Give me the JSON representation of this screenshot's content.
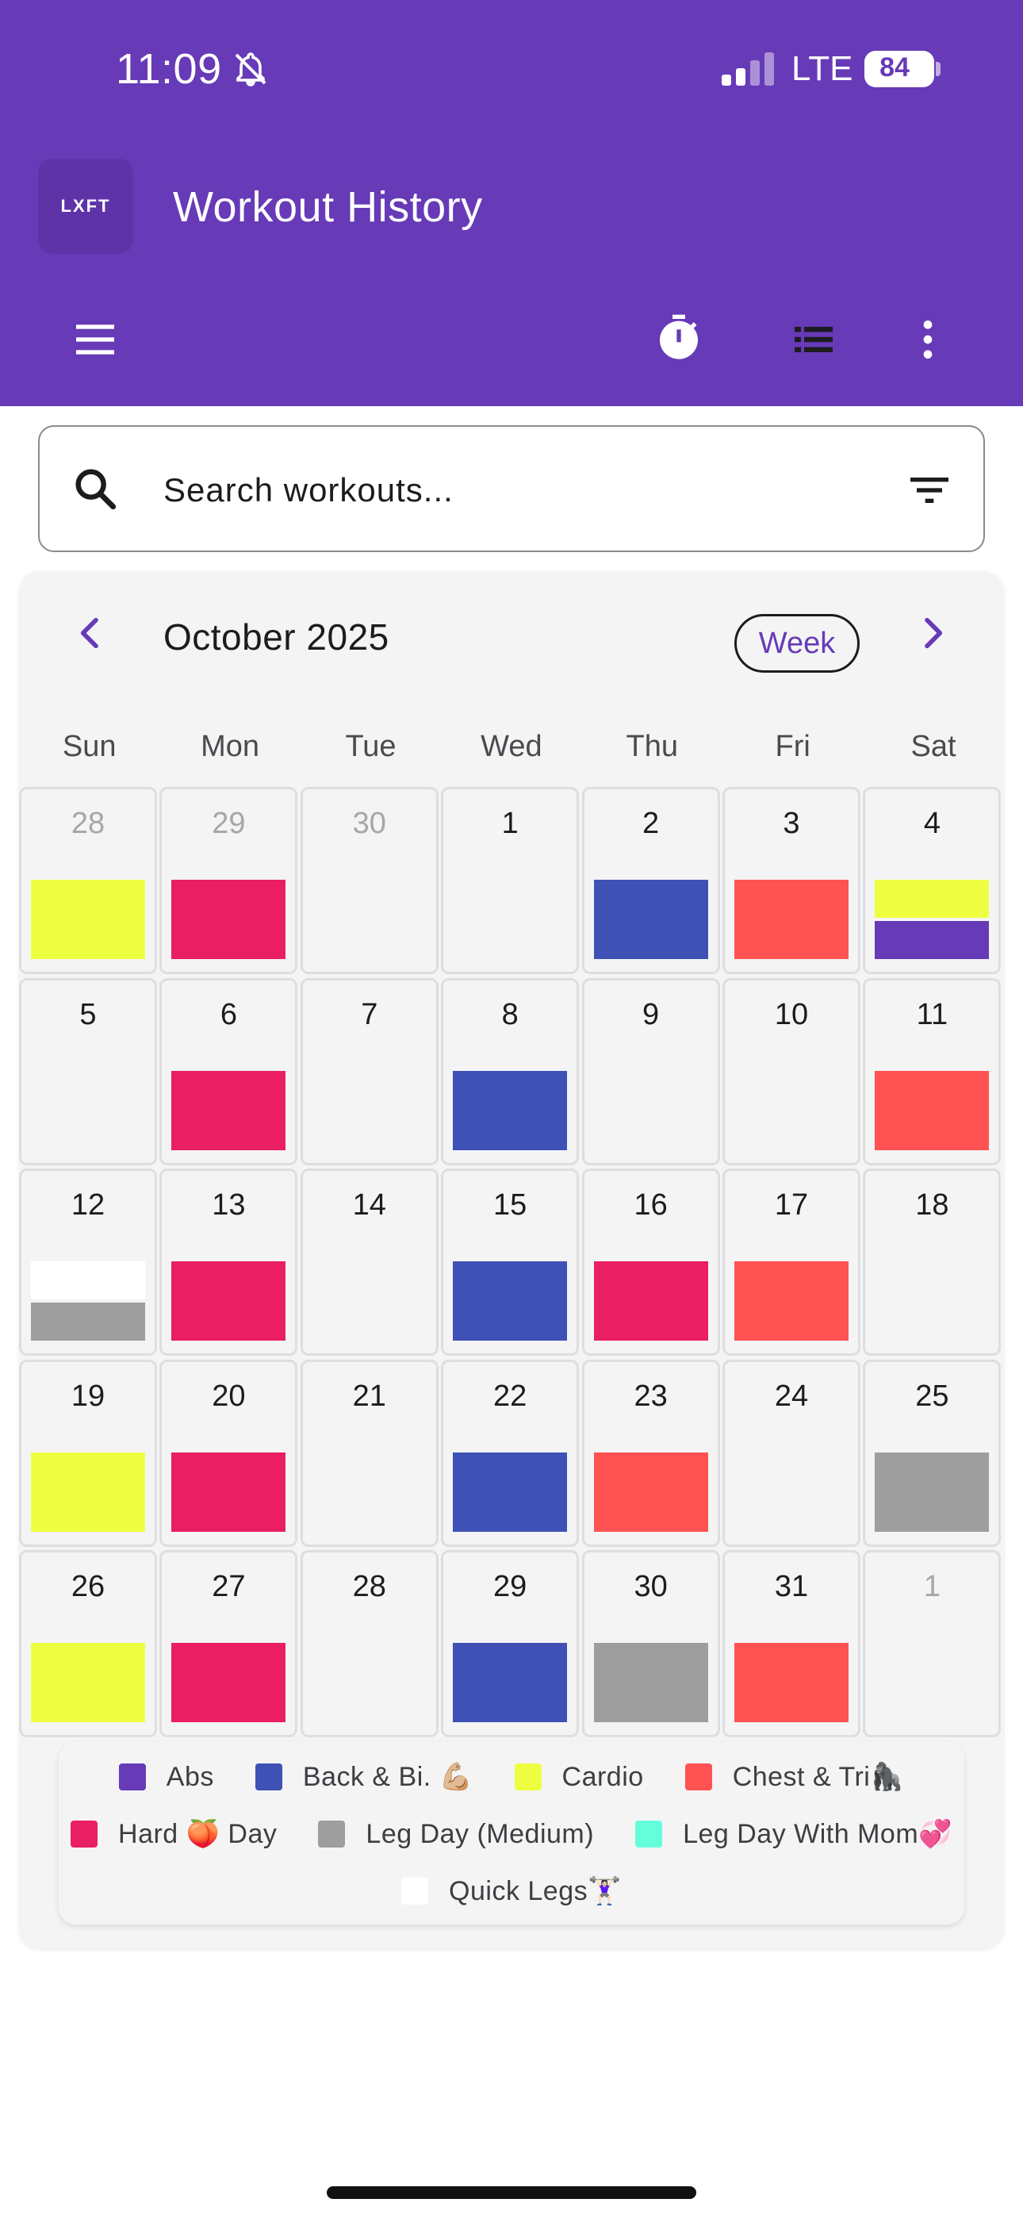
{
  "status_bar": {
    "time": "11:09",
    "network": "LTE",
    "battery": "84",
    "battery_level": 0.84
  },
  "header": {
    "logo_text": "LXFT",
    "title": "Workout History"
  },
  "toolbar": {
    "icons": [
      "menu-icon",
      "timer-icon",
      "list-icon",
      "more-vertical-icon"
    ]
  },
  "search": {
    "placeholder": "Search workouts..."
  },
  "calendar": {
    "month_label": "October 2025",
    "view_button": "Week",
    "weekdays": [
      "Sun",
      "Mon",
      "Tue",
      "Wed",
      "Thu",
      "Fri",
      "Sat"
    ],
    "weeks": [
      [
        {
          "day": "28",
          "outside": true,
          "workouts": [
            "Cardio"
          ]
        },
        {
          "day": "29",
          "outside": true,
          "workouts": [
            "Hard 🍑 Day"
          ]
        },
        {
          "day": "30",
          "outside": true,
          "workouts": []
        },
        {
          "day": "1",
          "workouts": []
        },
        {
          "day": "2",
          "workouts": [
            "Back & Bi. 💪🏼"
          ]
        },
        {
          "day": "3",
          "workouts": [
            "Chest & Tri🦍"
          ]
        },
        {
          "day": "4",
          "workouts": [
            "Cardio",
            "Abs"
          ]
        }
      ],
      [
        {
          "day": "5",
          "workouts": []
        },
        {
          "day": "6",
          "workouts": [
            "Hard 🍑 Day"
          ]
        },
        {
          "day": "7",
          "workouts": []
        },
        {
          "day": "8",
          "workouts": [
            "Back & Bi. 💪🏼"
          ]
        },
        {
          "day": "9",
          "workouts": []
        },
        {
          "day": "10",
          "workouts": []
        },
        {
          "day": "11",
          "workouts": [
            "Chest & Tri🦍"
          ]
        }
      ],
      [
        {
          "day": "12",
          "workouts": [
            "Quick Legs🏋🏻‍♀️",
            "Leg Day (Medium)"
          ]
        },
        {
          "day": "13",
          "workouts": [
            "Hard 🍑 Day"
          ]
        },
        {
          "day": "14",
          "workouts": []
        },
        {
          "day": "15",
          "workouts": [
            "Back & Bi. 💪🏼"
          ]
        },
        {
          "day": "16",
          "workouts": [
            "Hard 🍑 Day"
          ]
        },
        {
          "day": "17",
          "workouts": [
            "Chest & Tri🦍"
          ]
        },
        {
          "day": "18",
          "workouts": []
        }
      ],
      [
        {
          "day": "19",
          "workouts": [
            "Cardio"
          ]
        },
        {
          "day": "20",
          "workouts": [
            "Hard 🍑 Day"
          ]
        },
        {
          "day": "21",
          "workouts": []
        },
        {
          "day": "22",
          "workouts": [
            "Back & Bi. 💪🏼"
          ]
        },
        {
          "day": "23",
          "workouts": [
            "Chest & Tri🦍"
          ]
        },
        {
          "day": "24",
          "workouts": []
        },
        {
          "day": "25",
          "workouts": [
            "Leg Day (Medium)"
          ]
        }
      ],
      [
        {
          "day": "26",
          "workouts": [
            "Cardio"
          ]
        },
        {
          "day": "27",
          "workouts": [
            "Hard 🍑 Day"
          ]
        },
        {
          "day": "28",
          "workouts": []
        },
        {
          "day": "29",
          "workouts": [
            "Back & Bi. 💪🏼"
          ]
        },
        {
          "day": "30",
          "workouts": [
            "Leg Day (Medium)"
          ]
        },
        {
          "day": "31",
          "workouts": [
            "Chest & Tri🦍"
          ]
        },
        {
          "day": "1",
          "outside": true,
          "workouts": []
        }
      ]
    ]
  },
  "legend": [
    {
      "label": "Abs",
      "color": "#673ab7"
    },
    {
      "label": "Back & Bi. 💪🏼",
      "color": "#3f51b5"
    },
    {
      "label": "Cardio",
      "color": "#eeff41"
    },
    {
      "label": "Chest & Tri🦍",
      "color": "#ff5252"
    },
    {
      "label": "Hard 🍑 Day",
      "color": "#e91e63"
    },
    {
      "label": "Leg Day (Medium)",
      "color": "#9e9e9e"
    },
    {
      "label": "Leg Day With Mom💞",
      "color": "#64ffda"
    },
    {
      "label": "Quick Legs🏋🏻‍♀️",
      "color": "#ffffff"
    }
  ],
  "colors": {
    "primary": "#673ab7",
    "card_background": "#f4f4f5"
  }
}
